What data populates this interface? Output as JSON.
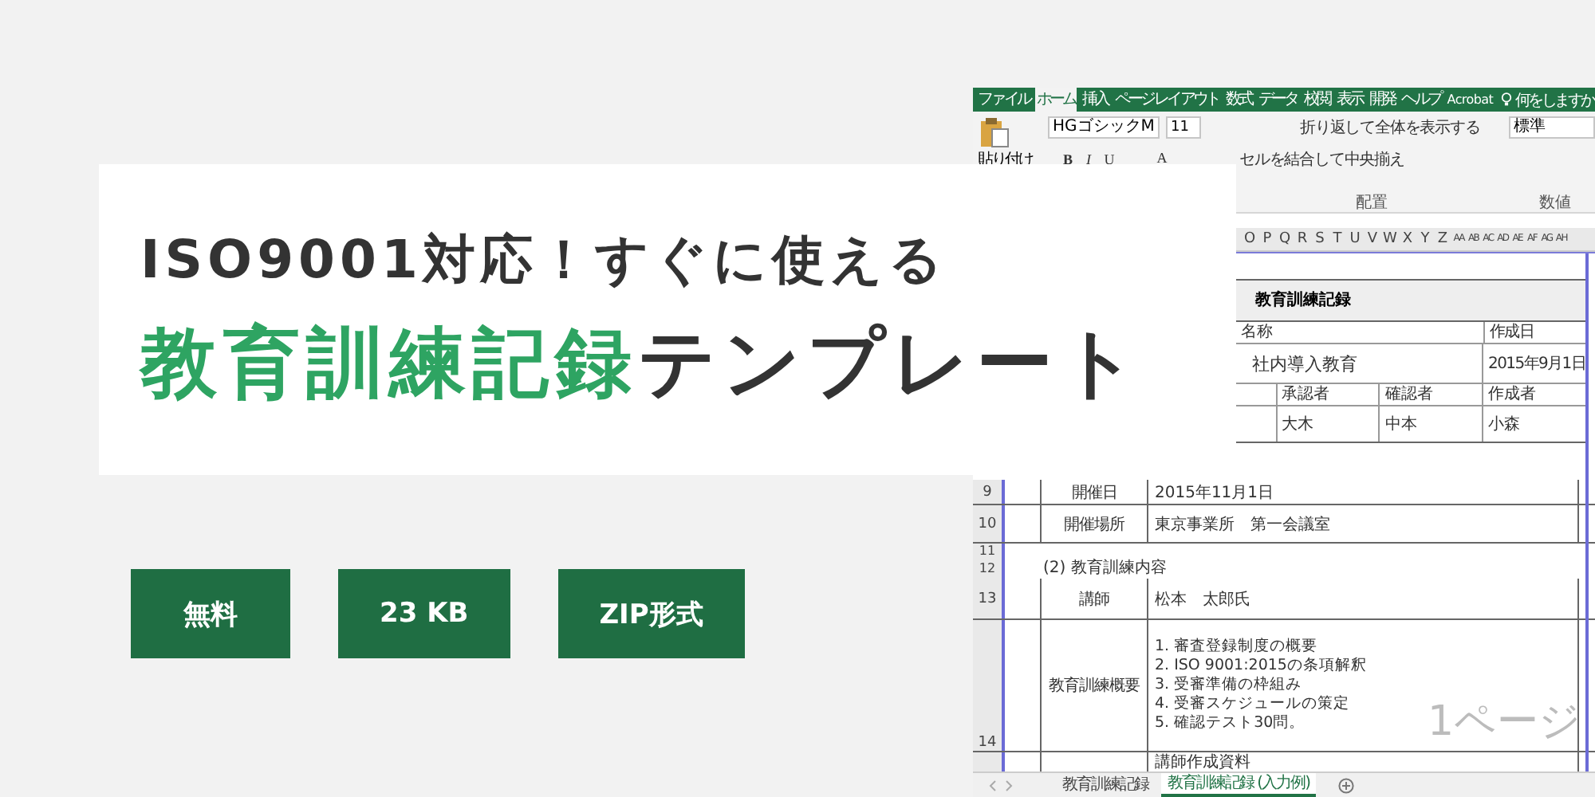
{
  "headline": {
    "line1": "ISO9001対応！すぐに使える",
    "highlight": "教育訓練記録",
    "rest": "テンプレート"
  },
  "badges": [
    "無料",
    "23 KB",
    "ZIP形式"
  ],
  "excel": {
    "ribbon_tabs": [
      {
        "label": "ファイル",
        "selected": false
      },
      {
        "label": "ホーム",
        "selected": true
      },
      {
        "label": "挿入",
        "selected": false
      },
      {
        "label": "ページレイアウト",
        "selected": false
      },
      {
        "label": "数式",
        "selected": false
      },
      {
        "label": "データ",
        "selected": false
      },
      {
        "label": "校閲",
        "selected": false
      },
      {
        "label": "表示",
        "selected": false
      },
      {
        "label": "開発",
        "selected": false
      },
      {
        "label": "ヘルプ",
        "selected": false
      },
      {
        "label": "Acrobat",
        "selected": false
      }
    ],
    "tell_me": "何をしますか",
    "paste_label": "貼り付け",
    "font_name": "HGゴシックM",
    "font_size": "11",
    "format_buttons": [
      "B",
      "I",
      "U",
      "A"
    ],
    "wrap_text": "折り返して全体を表示する",
    "merge_center": "セルを結合して中央揃え",
    "number_format": "標準",
    "group_labels": [
      "配置",
      "数値"
    ],
    "columns": [
      "O",
      "P",
      "Q",
      "R",
      "S",
      "T",
      "U",
      "V",
      "W",
      "X",
      "Y",
      "Z",
      "AA",
      "AB",
      "AC",
      "AD",
      "AE",
      "AF",
      "AG",
      "AH"
    ],
    "form_top": {
      "title": "教育訓練記録",
      "name_label": "名称",
      "date_label": "作成日",
      "name_value": "社内導入教育",
      "date_value": "2015年9月1日",
      "roles": [
        "承認者",
        "確認者",
        "作成者"
      ],
      "signers": [
        "大木",
        "中本",
        "小森"
      ]
    },
    "rows": [
      {
        "number": "9",
        "label": "開催日",
        "value": "2015年11月1日"
      },
      {
        "number": "10",
        "label": "開催場所",
        "value": "東京事業所　第一会議室"
      }
    ],
    "blank_row": "11",
    "section": {
      "number": "12",
      "text": "(2) 教育訓練内容"
    },
    "teacher": {
      "number": "13",
      "label": "講師",
      "value": "松本　太郎氏"
    },
    "outline": {
      "number": "14",
      "label": "教育訓練概要",
      "items": [
        "1. 審査登録制度の概要",
        "2. ISO 9001:2015の条項解釈",
        "3. 受審準備の枠組み",
        "4. 受審スケジュールの策定",
        "5. 確認テスト30問。"
      ]
    },
    "materials": "講師作成資料",
    "page_mark": "1ページ",
    "sheet_tabs": [
      {
        "label": "教育訓練記録",
        "selected": false
      },
      {
        "label": "教育訓練記録 (入力例)",
        "selected": true
      }
    ]
  }
}
